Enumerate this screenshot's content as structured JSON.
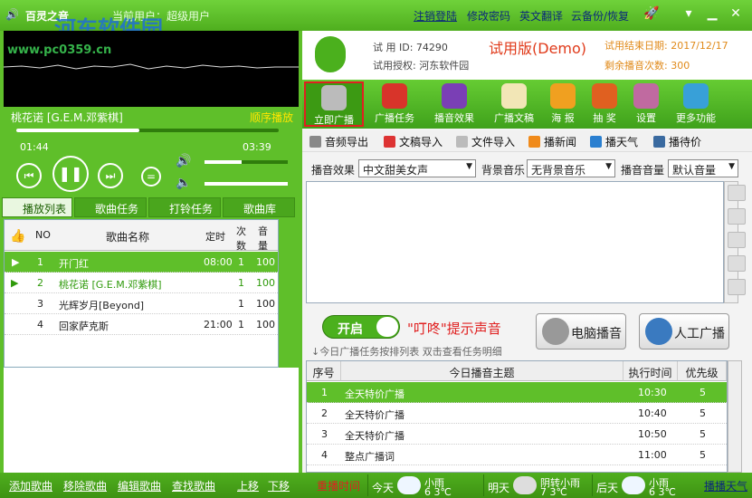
{
  "app": {
    "title_left": "百灵之音",
    "current_user_label": "当前用户：超级用户",
    "watermark_title": "河东软件园",
    "watermark_url": "www.pc0359.cn",
    "links": [
      "注销登陆",
      "修改密码",
      "英文翻译",
      "云备份/恢复"
    ]
  },
  "player": {
    "now_playing": "桃花诺 [G.E.M.邓紫棋]",
    "play_mode": "顺序播放",
    "elapsed": "01:44",
    "total": "03:39",
    "progress": 0.47,
    "volume": 0.45
  },
  "left_tabs": [
    "播放列表",
    "歌曲任务",
    "打铃任务",
    "歌曲库"
  ],
  "playlist": {
    "headers": {
      "no": "NO",
      "name": "歌曲名称",
      "time": "定时",
      "count": "次数",
      "vol": "音量"
    },
    "rows": [
      {
        "no": "1",
        "name": "开门红",
        "time": "08:00",
        "count": "1",
        "vol": "100"
      },
      {
        "no": "2",
        "name": "桃花诺 [G.E.M.邓紫棋]",
        "time": "",
        "count": "1",
        "vol": "100"
      },
      {
        "no": "3",
        "name": "光辉岁月[Beyond]",
        "time": "",
        "count": "1",
        "vol": "100"
      },
      {
        "no": "4",
        "name": "回家萨克斯",
        "time": "21:00",
        "count": "1",
        "vol": "100"
      }
    ]
  },
  "info": {
    "trial_id": "试 用 ID: 74290",
    "trial_auth": "试用授权: 河东软件园",
    "edition": "试用版(Demo)",
    "trial_end": "试用结束日期: 2017/12/17",
    "remaining": "剩余播音次数: 300"
  },
  "toolbar": [
    "立即广播",
    "广播任务",
    "播音效果",
    "广播文稿",
    "海 报",
    "抽 奖",
    "设置",
    "更多功能"
  ],
  "subtoolbar": [
    "音频导出",
    "文稿导入",
    "文件导入",
    "播新闻",
    "播天气",
    "播待价"
  ],
  "options": {
    "effect_label": "播音效果",
    "effect_value": "中文甜美女声",
    "bgm_label": "背景音乐",
    "bgm_value": "无背景音乐",
    "volume_label": "播音音量",
    "volume_value": "默认音量"
  },
  "controls": {
    "toggle_label": "开启",
    "chime_text": "\"叮咚\"提示声音",
    "pc_button": "电脑播音",
    "manual_button": "人工广播",
    "hint": "↓今日广播任务按排列表  双击查看任务明细"
  },
  "tasks": {
    "headers": {
      "no": "序号",
      "topic": "今日播音主题",
      "time": "执行时间",
      "priority": "优先级"
    },
    "rows": [
      {
        "no": "1",
        "topic": "全天特价广播",
        "time": "10:30",
        "priority": "5"
      },
      {
        "no": "2",
        "topic": "全天特价广播",
        "time": "10:40",
        "priority": "5"
      },
      {
        "no": "3",
        "topic": "全天特价广播",
        "time": "10:50",
        "priority": "5"
      },
      {
        "no": "4",
        "topic": "整点广播词",
        "time": "11:00",
        "priority": "5"
      }
    ]
  },
  "bottom": {
    "links": [
      "添加歌曲",
      "移除歌曲",
      "编辑歌曲",
      "查找歌曲",
      "上移",
      "下移"
    ],
    "alert": "重播时间",
    "today_label": "今天",
    "today_weather": "小雨",
    "today_temp": "6  3℃",
    "tomorrow_label": "明天",
    "tomorrow_weather": "阴转小雨",
    "tomorrow_temp": "7  3℃",
    "after_label": "后天",
    "after_weather": "小雨",
    "after_temp": "6  3℃",
    "play_weather": "播播天气"
  }
}
